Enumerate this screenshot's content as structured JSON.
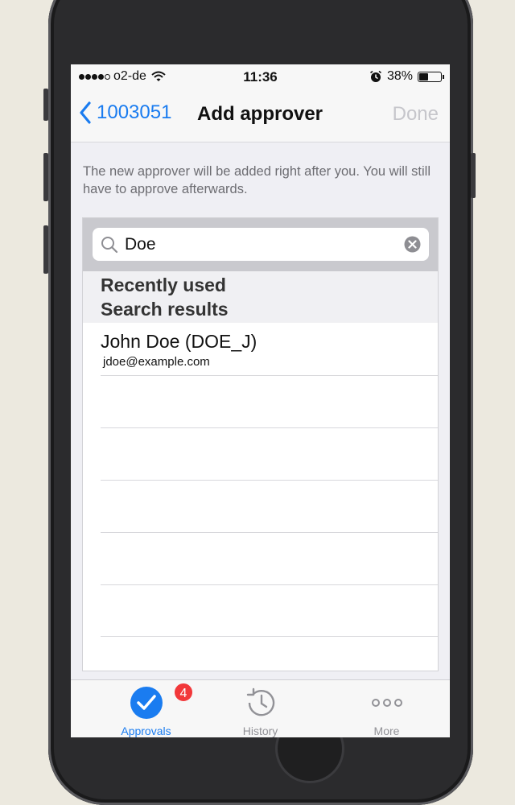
{
  "status_bar": {
    "carrier": "o2-de",
    "time": "11:36",
    "battery": "38%",
    "battery_level": 0.38,
    "icons": [
      "signal-dots-icon",
      "wifi-icon",
      "alarm-icon",
      "battery-icon"
    ]
  },
  "nav": {
    "back_label": "1003051",
    "title": "Add approver",
    "done_label": "Done"
  },
  "info_text": "The new approver will be added right after you. You will still have to approve afterwards.",
  "search": {
    "value": "Doe",
    "placeholder": ""
  },
  "sections": {
    "recent": "Recently used",
    "results": "Search results"
  },
  "results": [
    {
      "name": "John Doe (DOE_J)",
      "email": "jdoe@example.com"
    }
  ],
  "tabs": [
    {
      "label": "Approvals",
      "badge": "4",
      "icon": "checkmark-circle-icon",
      "active": true
    },
    {
      "label": "History",
      "icon": "history-clock-icon",
      "active": false
    },
    {
      "label": "More",
      "icon": "more-dots-icon",
      "active": false
    }
  ],
  "colors": {
    "accent": "#1a7cf0",
    "badge": "#f2383a",
    "disabled": "#c6c6cb"
  }
}
